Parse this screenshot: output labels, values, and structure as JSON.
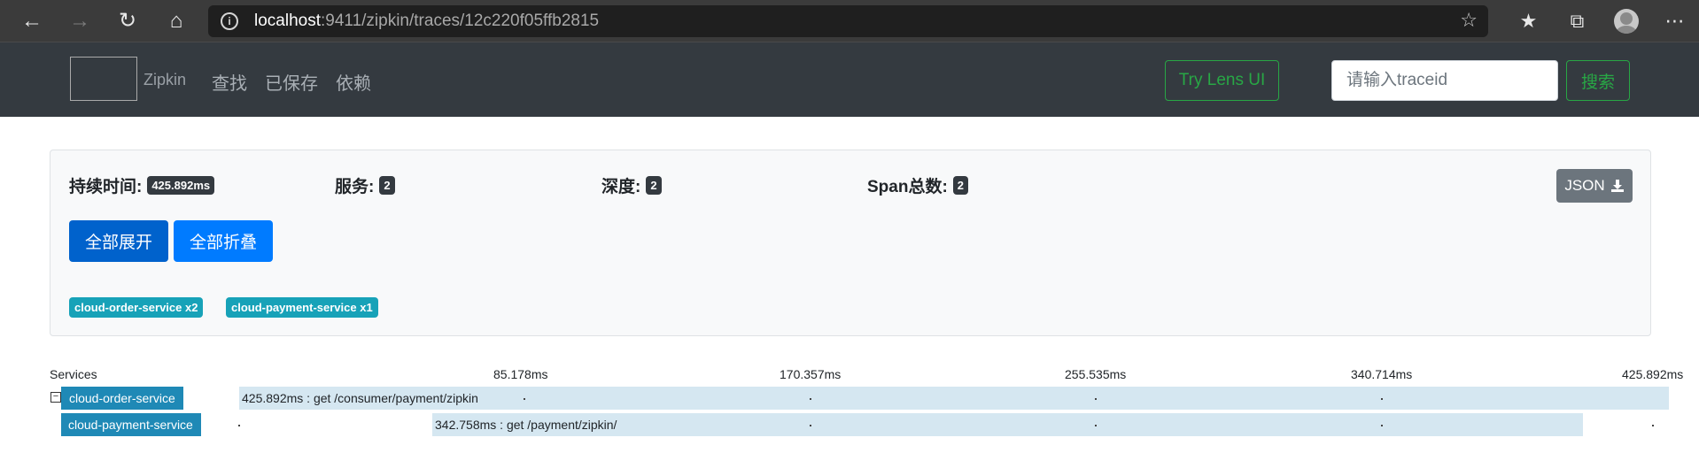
{
  "browser": {
    "url_host": "localhost",
    "url_rest": ":9411/zipkin/traces/12c220f05ffb2815"
  },
  "navbar": {
    "brand": "Zipkin",
    "links": [
      "查找",
      "已保存",
      "依赖"
    ],
    "lens_button": "Try Lens UI",
    "traceid_placeholder": "请输入traceid",
    "search_button": "搜索"
  },
  "summary": {
    "duration_label": "持续时间:",
    "duration_value": "425.892ms",
    "services_label": "服务:",
    "services_value": "2",
    "depth_label": "深度:",
    "depth_value": "2",
    "spans_label": "Span总数:",
    "spans_value": "2",
    "json_button": "JSON",
    "expand_all": "全部展开",
    "collapse_all": "全部折叠",
    "service_badges": [
      "cloud-order-service x2",
      "cloud-payment-service x1"
    ]
  },
  "timeline": {
    "services_header": "Services",
    "ticks": [
      "85.178ms",
      "170.357ms",
      "255.535ms",
      "340.714ms",
      "425.892ms"
    ],
    "rows": [
      {
        "service": "cloud-order-service",
        "label": "425.892ms : get /consumer/payment/zipkin",
        "toggle": "−"
      },
      {
        "service": "cloud-payment-service",
        "label": "342.758ms : get /payment/zipkin/"
      }
    ]
  },
  "colors": {
    "navbar_bg": "#343a40",
    "success": "#28a745",
    "primary": "#007bff",
    "primary_active": "#0062cc",
    "info": "#17a2b8",
    "secondary": "#6c757d",
    "service_label_bg": "#1f89b6"
  }
}
